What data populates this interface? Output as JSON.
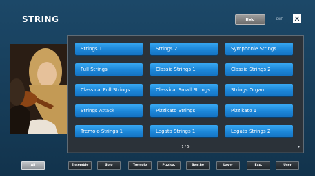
{
  "header": {
    "title": "STRING",
    "hold_label": "Hold",
    "exit_label": "EXIT",
    "close_glyph": "✕"
  },
  "voices": [
    "Strings 1",
    "Strings 2",
    "Symphonie Strings",
    "Full Strings",
    "Classic Strings 1",
    "Classic Strings 2",
    "Classical Full Strings",
    "Classical Small Strings",
    "Strings Organ",
    "Strings Attack",
    "Pizzikato Strings",
    "Pizzikato 1",
    "Tremolo Strings 1",
    "Legato Strings 1",
    "Legato Strings 2"
  ],
  "pager": {
    "label": "1 / 5",
    "next_glyph": "▸"
  },
  "tabs": [
    {
      "label": "All",
      "active": true
    },
    {
      "label": "Ensemble",
      "active": false
    },
    {
      "label": "Solo",
      "active": false
    },
    {
      "label": "Tremolo",
      "active": false
    },
    {
      "label": "Pizzica.",
      "active": false
    },
    {
      "label": "Synthe",
      "active": false
    },
    {
      "label": "Layer",
      "active": false
    },
    {
      "label": "Exp.",
      "active": false
    },
    {
      "label": "User",
      "active": false
    }
  ],
  "colors": {
    "voice_button": "#1c86d8",
    "panel": "#2b3239",
    "background": "#1c4868"
  }
}
